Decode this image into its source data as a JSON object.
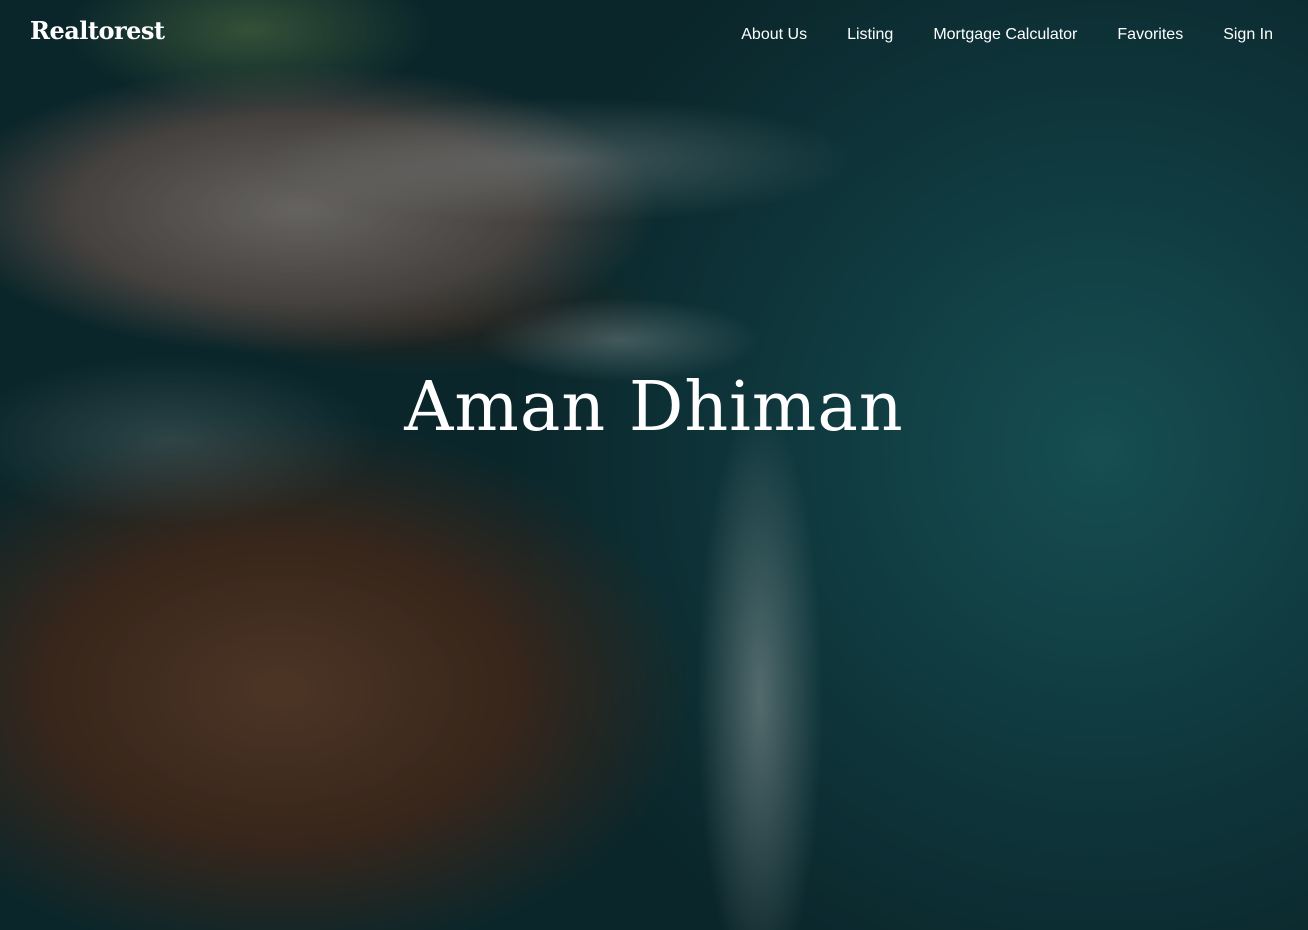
{
  "brand": {
    "logo_text": "Realtorest"
  },
  "nav": {
    "items": [
      {
        "label": "About Us"
      },
      {
        "label": "Listing"
      },
      {
        "label": "Mortgage Calculator"
      },
      {
        "label": "Favorites"
      },
      {
        "label": "Sign In"
      }
    ]
  },
  "hero": {
    "title": "Aman Dhiman",
    "background": "aerial-coastline-image"
  }
}
